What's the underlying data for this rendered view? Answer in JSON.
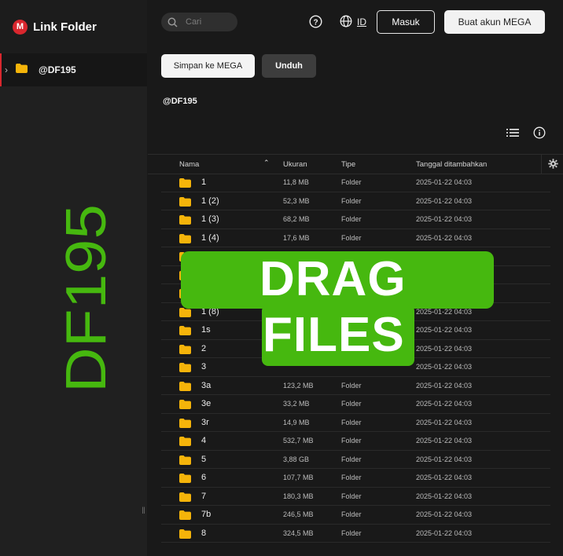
{
  "sidebar": {
    "brand": "Link Folder",
    "brand_badge": "M",
    "tree": [
      {
        "label": "@DF195",
        "chevron": "›"
      }
    ],
    "watermark": "DF195",
    "watermark_color": "#46b80f"
  },
  "topbar": {
    "search_placeholder": "Cari",
    "language": "ID",
    "login_label": "Masuk",
    "create_account_label": "Buat akun MEGA"
  },
  "actions": {
    "save_label": "Simpan ke MEGA",
    "download_label": "Unduh"
  },
  "folder_title": "@DF195",
  "table": {
    "columns": [
      "Nama",
      "Ukuran",
      "Tipe",
      "Tanggal ditambahkan"
    ],
    "rows": [
      {
        "name": "1",
        "size": "11,8 MB",
        "type": "Folder",
        "date": "2025-01-22 04:03"
      },
      {
        "name": "1 (2)",
        "size": "52,3 MB",
        "type": "Folder",
        "date": "2025-01-22 04:03"
      },
      {
        "name": "1 (3)",
        "size": "68,2 MB",
        "type": "Folder",
        "date": "2025-01-22 04:03"
      },
      {
        "name": "1 (4)",
        "size": "17,6 MB",
        "type": "Folder",
        "date": "2025-01-22 04:03"
      },
      {
        "name": "",
        "size": "",
        "type": "",
        "date": ""
      },
      {
        "name": "",
        "size": "",
        "type": "",
        "date": ""
      },
      {
        "name": "",
        "size": "",
        "type": "",
        "date": ""
      },
      {
        "name": "1 (8)",
        "size": "",
        "type": "",
        "date": "2025-01-22 04:03"
      },
      {
        "name": "1s",
        "size": "",
        "type": "",
        "date": "2025-01-22 04:03"
      },
      {
        "name": "2",
        "size": "",
        "type": "",
        "date": "2025-01-22 04:03"
      },
      {
        "name": "3",
        "size": "",
        "type": "",
        "date": "2025-01-22 04:03"
      },
      {
        "name": "3a",
        "size": "123,2 MB",
        "type": "Folder",
        "date": "2025-01-22 04:03"
      },
      {
        "name": "3e",
        "size": "33,2 MB",
        "type": "Folder",
        "date": "2025-01-22 04:03"
      },
      {
        "name": "3r",
        "size": "14,9 MB",
        "type": "Folder",
        "date": "2025-01-22 04:03"
      },
      {
        "name": "4",
        "size": "532,7 MB",
        "type": "Folder",
        "date": "2025-01-22 04:03"
      },
      {
        "name": "5",
        "size": "3,88 GB",
        "type": "Folder",
        "date": "2025-01-22 04:03"
      },
      {
        "name": "6",
        "size": "107,7 MB",
        "type": "Folder",
        "date": "2025-01-22 04:03"
      },
      {
        "name": "7",
        "size": "180,3 MB",
        "type": "Folder",
        "date": "2025-01-22 04:03"
      },
      {
        "name": "7b",
        "size": "246,5 MB",
        "type": "Folder",
        "date": "2025-01-22 04:03"
      },
      {
        "name": "8",
        "size": "324,5 MB",
        "type": "Folder",
        "date": "2025-01-22 04:03"
      }
    ]
  },
  "overlay": {
    "line1": "DRAG",
    "line2": "FILES",
    "color": "#46b80f"
  },
  "icons": {
    "folder_color": "#f5b40a",
    "accent": "#d9272e"
  }
}
